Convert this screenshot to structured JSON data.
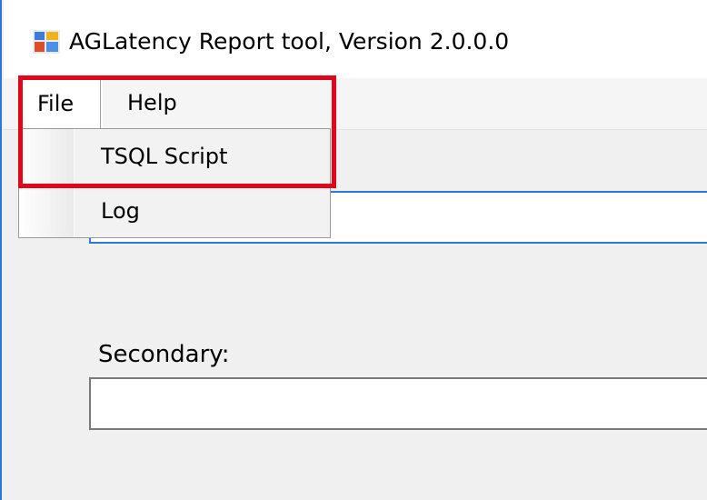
{
  "window": {
    "title": "AGLatency Report tool, Version 2.0.0.0",
    "icon": "app-window-icon"
  },
  "menubar": {
    "items": [
      {
        "label": "File",
        "state": "open"
      },
      {
        "label": "Help"
      }
    ]
  },
  "file_menu": {
    "items": [
      {
        "label": "TSQL Script"
      },
      {
        "label": "Log"
      }
    ]
  },
  "form": {
    "primary_value": "",
    "secondary_label": "Secondary:",
    "secondary_value": ""
  },
  "colors": {
    "highlight_box": "#e3061a",
    "focus_border": "#2b79d8",
    "window_bg": "#f0f0f0"
  }
}
